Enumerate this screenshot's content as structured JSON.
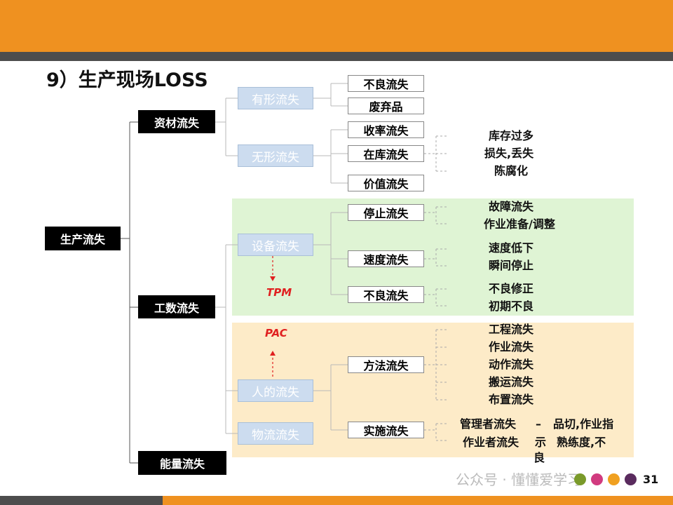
{
  "title": "9）生产现场LOSS",
  "root": "生产流失",
  "level1": [
    "资材流失",
    "工数流失",
    "能量流失"
  ],
  "level2": {
    "tangible": "有形流失",
    "intangible": "无形流失",
    "equipment": "设备流失",
    "human": "人的流失",
    "logistics": "物流流失"
  },
  "level3": {
    "bad": "不良流失",
    "waste": "废弃品",
    "yield": "收率流失",
    "stock": "在库流失",
    "value": "价值流失",
    "stop": "停止流失",
    "speed": "速度流失",
    "defect": "不良流失",
    "method": "方法流失",
    "implement": "实施流失"
  },
  "details": {
    "stock": [
      "库存过多",
      "损失,丢失",
      "陈腐化"
    ],
    "stop": [
      "故障流失",
      "作业准备/调整"
    ],
    "speed": [
      "速度低下",
      "瞬间停止"
    ],
    "defect": [
      "不良修正",
      "初期不良"
    ],
    "method": [
      "工程流失",
      "作业流失",
      "动作流失",
      "搬运流失",
      "布置流失"
    ],
    "implement_left": [
      "管理者流失",
      "作业者流失"
    ],
    "implement_dash": "–",
    "implement_mid": [
      "示",
      "良"
    ],
    "implement_right": [
      "品切,作业指",
      "熟练度,不"
    ]
  },
  "annotations": {
    "tpm": "TPM",
    "pac": "PAC"
  },
  "watermark": "公众号 · 懂懂爱学习",
  "page_number": "31",
  "colors": {
    "orange": "#ef9120",
    "dark_gray": "#4d4d4d",
    "green_zone": "#dff4d4",
    "cream_zone": "#fdebc8",
    "red": "#e02020"
  }
}
